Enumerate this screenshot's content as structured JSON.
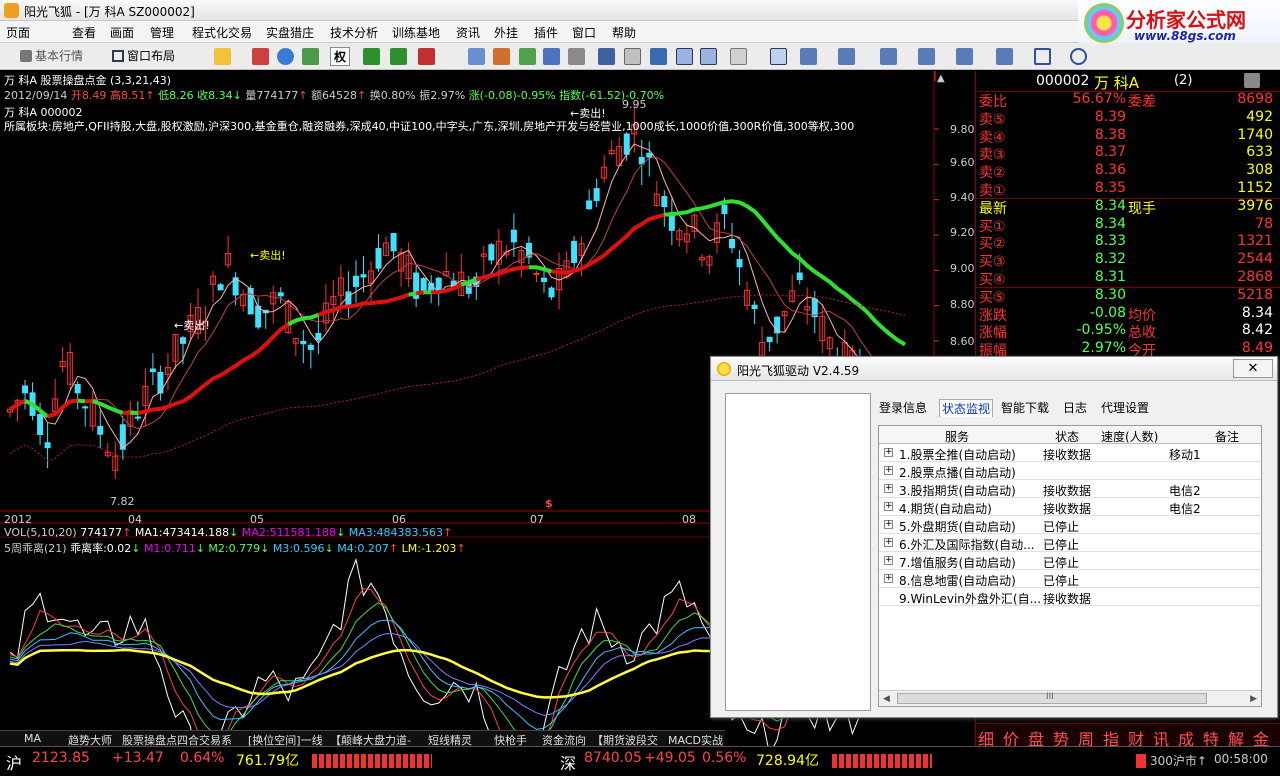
{
  "window": {
    "title": "阳光飞狐 - [万  科A  SZ000002]"
  },
  "menu": [
    "页面",
    "查看",
    "画面",
    "管理",
    "程式化交易",
    "实盘猎庄",
    "技术分析",
    "训练基地",
    "资讯",
    "外挂",
    "插件",
    "窗口",
    "帮助"
  ],
  "brand": {
    "name": "分析家公式网",
    "url": "www.88gs.com"
  },
  "toolbar": {
    "basic_quote": "基本行情",
    "window_layout": "窗口布局",
    "quan": "权"
  },
  "chart_header": {
    "indicator": "万  科A  股票操盘点金 (3,3,21,43)",
    "date": "2012/09/14",
    "open": "开8.49",
    "high": "高8.51",
    "low": "低8.26",
    "close": "收8.34",
    "vol": "量774177",
    "amount": "额64528",
    "turnover": "换0.80%",
    "amplitude": "振2.97%",
    "change": "涨(-0.08)-0.95%",
    "index": "指数(-61.52)-0.70%",
    "stock_line": "万  科A  000002",
    "sectors": "所属板块:房地产,QFII持股,大盘,股权激励,沪深300,基金重仓,融资融券,深成40,中证100,中字头,广东,深圳,房地产开发与经营业,1000成长,1000价值,300R价值,300等权,300"
  },
  "annotations": {
    "sell1": "←卖出!",
    "sell2": "←卖出!",
    "sell3": "←卖出!",
    "high_label": "9.95",
    "low_label": "7.82",
    "dollar": "$"
  },
  "price_axis": [
    "9.80",
    "9.60",
    "9.40",
    "9.20",
    "9.00",
    "8.80",
    "8.60"
  ],
  "date_axis": [
    "2012",
    "04",
    "05",
    "06",
    "07",
    "08"
  ],
  "vol_line": {
    "label": "VOL(5,10,20)",
    "v": "774177",
    "ma1": "MA1:473414.188",
    "ma2": "MA2:511581.188",
    "ma3": "MA3:484383.563"
  },
  "osc_line": {
    "label": "5周乖离(21)",
    "v": "乖离率:0.02",
    "m1": "M1:0.711",
    "m2": "M2:0.779",
    "m3": "M3:0.596",
    "m4": "M4:0.207",
    "lm": "LM:-1.203"
  },
  "chart_data": {
    "type": "candlestick",
    "title": "万科A 股票操盘点金",
    "ylim": [
      7.82,
      9.95
    ],
    "y_ticks": [
      8.6,
      8.8,
      9.0,
      9.2,
      9.4,
      9.6,
      9.8
    ],
    "x_labels": [
      "2012",
      "04",
      "05",
      "06",
      "07",
      "08"
    ],
    "high": 9.95,
    "low": 7.82,
    "last": {
      "date": "2012/09/14",
      "open": 8.49,
      "high": 8.51,
      "low": 8.26,
      "close": 8.34
    },
    "close_series": [
      8.2,
      8.35,
      8.05,
      8.5,
      8.3,
      8.1,
      7.95,
      8.2,
      8.35,
      8.5,
      8.65,
      8.8,
      9.05,
      8.9,
      8.75,
      8.85,
      8.65,
      8.55,
      8.8,
      8.9,
      9.0,
      9.15,
      9.05,
      8.85,
      9.0,
      8.95,
      8.9,
      9.1,
      9.15,
      9.05,
      8.85,
      8.95,
      9.2,
      9.55,
      9.7,
      9.8,
      9.5,
      9.3,
      9.25,
      9.1,
      9.3,
      8.95,
      8.6,
      8.7,
      8.9,
      8.75,
      8.55,
      8.45,
      8.4,
      8.35,
      8.34
    ]
  },
  "quote": {
    "code": "000002",
    "name": "万  科A",
    "suffix": "(2)",
    "weibi": {
      "label": "委比",
      "value": "56.67%",
      "label2": "委差",
      "value2": "8698"
    },
    "sell": [
      {
        "label": "卖⑤",
        "price": "8.39",
        "vol": "492"
      },
      {
        "label": "卖④",
        "price": "8.38",
        "vol": "1740"
      },
      {
        "label": "卖③",
        "price": "8.37",
        "vol": "633"
      },
      {
        "label": "卖②",
        "price": "8.36",
        "vol": "308"
      },
      {
        "label": "卖①",
        "price": "8.35",
        "vol": "1152"
      }
    ],
    "latest": {
      "label": "最新",
      "price": "8.34",
      "label2": "现手",
      "vol": "3976"
    },
    "buy": [
      {
        "label": "买①",
        "price": "8.34",
        "vol": "78"
      },
      {
        "label": "买②",
        "price": "8.33",
        "vol": "1321"
      },
      {
        "label": "买③",
        "price": "8.32",
        "vol": "2544"
      },
      {
        "label": "买④",
        "price": "8.31",
        "vol": "2868"
      },
      {
        "label": "买⑤",
        "price": "8.30",
        "vol": "5218"
      }
    ],
    "stats": [
      {
        "l": "涨跌",
        "v": "-0.08",
        "l2": "均价",
        "v2": "8.34"
      },
      {
        "l": "涨幅",
        "v": "-0.95%",
        "l2": "总收",
        "v2": "8.42"
      },
      {
        "l": "振幅",
        "v": "2.97%",
        "l2": "今开",
        "v2": "8.49"
      }
    ],
    "tabs": [
      "细",
      "价",
      "盘",
      "势",
      "周",
      "指",
      "财",
      "讯",
      "成",
      "特",
      "解",
      "金"
    ]
  },
  "bottom_tabs": [
    "MA",
    "趋势大师",
    "股票操盘点四合交易系",
    "[换位空间]一线",
    "【颠峰大盘力道-",
    "短线精灵",
    "快枪手",
    "资金流向",
    "【期货波段交",
    "MACD实战"
  ],
  "status": {
    "sh": "沪",
    "sh_index": "2123.85",
    "sh_chg": "+13.47",
    "sh_pct": "0.64%",
    "sh_amt": "761.79亿",
    "sz": "深",
    "sz_index": "8740.05",
    "sz_chg": "+49.05",
    "sz_pct": "0.56%",
    "sz_amt": "728.94亿",
    "market": "300沪市↑",
    "time": "00:58:00"
  },
  "dialog": {
    "title": "阳光飞狐驱动 V2.4.59",
    "close": "✕",
    "tabs": [
      "登录信息",
      "状态监视",
      "智能下载",
      "日志",
      "代理设置"
    ],
    "columns": [
      "服务",
      "状态",
      "速度(人数)",
      "备注"
    ],
    "rows": [
      {
        "name": "1.股票全推(自动启动)",
        "status": "接收数据",
        "speed": "",
        "note": "移动1"
      },
      {
        "name": "2.股票点播(自动启动)",
        "status": "",
        "speed": "",
        "note": ""
      },
      {
        "name": "3.股指期货(自动启动)",
        "status": "接收数据",
        "speed": "",
        "note": "电信2"
      },
      {
        "name": "4.期货(自动启动)",
        "status": "接收数据",
        "speed": "",
        "note": "电信2"
      },
      {
        "name": "5.外盘期货(自动启动)",
        "status": "已停止",
        "speed": "",
        "note": ""
      },
      {
        "name": "6.外汇及国际指数(自动...",
        "status": "已停止",
        "speed": "",
        "note": ""
      },
      {
        "name": "7.增值服务(自动启动)",
        "status": "已停止",
        "speed": "",
        "note": ""
      },
      {
        "name": "8.信息地雷(自动启动)",
        "status": "已停止",
        "speed": "",
        "note": ""
      },
      {
        "name": "9.WinLevin外盘外汇(自...",
        "status": "接收数据",
        "speed": "",
        "note": ""
      }
    ],
    "scroll_label": "III"
  }
}
